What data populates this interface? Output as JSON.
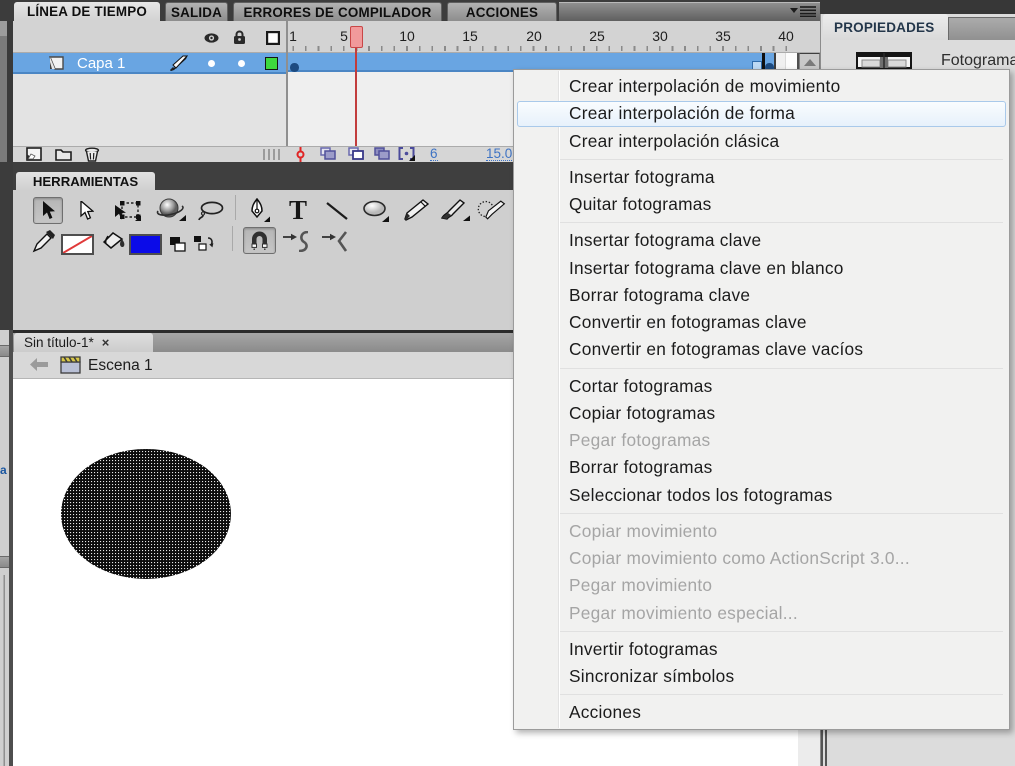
{
  "top_tabs": {
    "items": [
      {
        "label": "LÍNEA DE TIEMPO",
        "active": true
      },
      {
        "label": "SALIDA",
        "active": false
      },
      {
        "label": "ERRORES DE COMPILADOR",
        "active": false
      },
      {
        "label": "ACCIONES",
        "active": false
      }
    ]
  },
  "timeline": {
    "layer": {
      "name": "Capa 1",
      "selected": true,
      "outline_color": "#3ed83e",
      "keyframe_frame": 1
    },
    "ruler_labels": [
      "1",
      "5",
      "10",
      "15",
      "20",
      "25",
      "30",
      "35",
      "40"
    ],
    "playhead_frame": 6,
    "status": {
      "current_frame": "6",
      "frame_rate": "15.0"
    },
    "colors": {
      "selected_row": "#69a5e2",
      "keyframe_dot": "#1d4b81",
      "playhead_red": "#c23c3c"
    }
  },
  "tools": {
    "title": "HERRAMIENTAS",
    "fill_color": "#0b0be8",
    "row1": [
      "selection",
      "subselection",
      "free-transform",
      "3d-rotation",
      "lasso",
      "pen",
      "text",
      "line",
      "oval",
      "pencil",
      "brush",
      "deco"
    ],
    "row2": [
      "eyedropper",
      "stroke-color-none",
      "paint-bucket",
      "fill-color",
      "black-white",
      "swap-colors",
      "snap-magnet",
      "smooth",
      "straighten"
    ]
  },
  "document": {
    "tab_label": "Sin título-1*",
    "close_label": "×",
    "scene_label": "Escena 1"
  },
  "properties": {
    "title": "PROPIEDADES",
    "object_type": "Fotograma"
  },
  "sliver": {
    "letter": "a"
  },
  "context_menu": {
    "items": [
      {
        "label": "Crear interpolación de movimiento",
        "enabled": true,
        "highlighted": false
      },
      {
        "label": "Crear interpolación de forma",
        "enabled": true,
        "highlighted": true
      },
      {
        "label": "Crear interpolación clásica",
        "enabled": true,
        "highlighted": false
      },
      {
        "separator": true
      },
      {
        "label": "Insertar fotograma",
        "enabled": true,
        "highlighted": false
      },
      {
        "label": "Quitar fotogramas",
        "enabled": true,
        "highlighted": false
      },
      {
        "separator": true
      },
      {
        "label": "Insertar fotograma clave",
        "enabled": true,
        "highlighted": false
      },
      {
        "label": "Insertar fotograma clave en blanco",
        "enabled": true,
        "highlighted": false
      },
      {
        "label": "Borrar fotograma clave",
        "enabled": true,
        "highlighted": false
      },
      {
        "label": "Convertir en fotogramas clave",
        "enabled": true,
        "highlighted": false
      },
      {
        "label": "Convertir en fotogramas clave vacíos",
        "enabled": true,
        "highlighted": false
      },
      {
        "separator": true
      },
      {
        "label": "Cortar fotogramas",
        "enabled": true,
        "highlighted": false
      },
      {
        "label": "Copiar fotogramas",
        "enabled": true,
        "highlighted": false
      },
      {
        "label": "Pegar fotogramas",
        "enabled": false,
        "highlighted": false
      },
      {
        "label": "Borrar fotogramas",
        "enabled": true,
        "highlighted": false
      },
      {
        "label": "Seleccionar todos los fotogramas",
        "enabled": true,
        "highlighted": false
      },
      {
        "separator": true
      },
      {
        "label": "Copiar movimiento",
        "enabled": false,
        "highlighted": false
      },
      {
        "label": "Copiar movimiento como ActionScript 3.0...",
        "enabled": false,
        "highlighted": false
      },
      {
        "label": "Pegar movimiento",
        "enabled": false,
        "highlighted": false
      },
      {
        "label": "Pegar movimiento especial...",
        "enabled": false,
        "highlighted": false
      },
      {
        "separator": true
      },
      {
        "label": "Invertir fotogramas",
        "enabled": true,
        "highlighted": false
      },
      {
        "label": "Sincronizar símbolos",
        "enabled": true,
        "highlighted": false
      },
      {
        "separator": true
      },
      {
        "label": "Acciones",
        "enabled": true,
        "highlighted": false
      }
    ]
  }
}
